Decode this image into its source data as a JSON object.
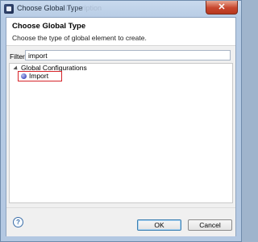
{
  "window": {
    "title": "Choose Global Type",
    "background_ghost": "Description",
    "close_symbol": "✕"
  },
  "header": {
    "title": "Choose Global Type",
    "description": "Choose the type of global element to create."
  },
  "filter": {
    "label": "Filter:",
    "value": "import"
  },
  "tree": {
    "group_label": "Global Configurations",
    "items": [
      {
        "label": "Import",
        "icon": "import-icon",
        "selected": true
      }
    ]
  },
  "footer": {
    "help_symbol": "?",
    "ok_label": "OK",
    "cancel_label": "Cancel"
  },
  "colors": {
    "highlight_border": "#d6242a",
    "window_frame": "#b6cbe4",
    "close_button": "#c7462d"
  }
}
